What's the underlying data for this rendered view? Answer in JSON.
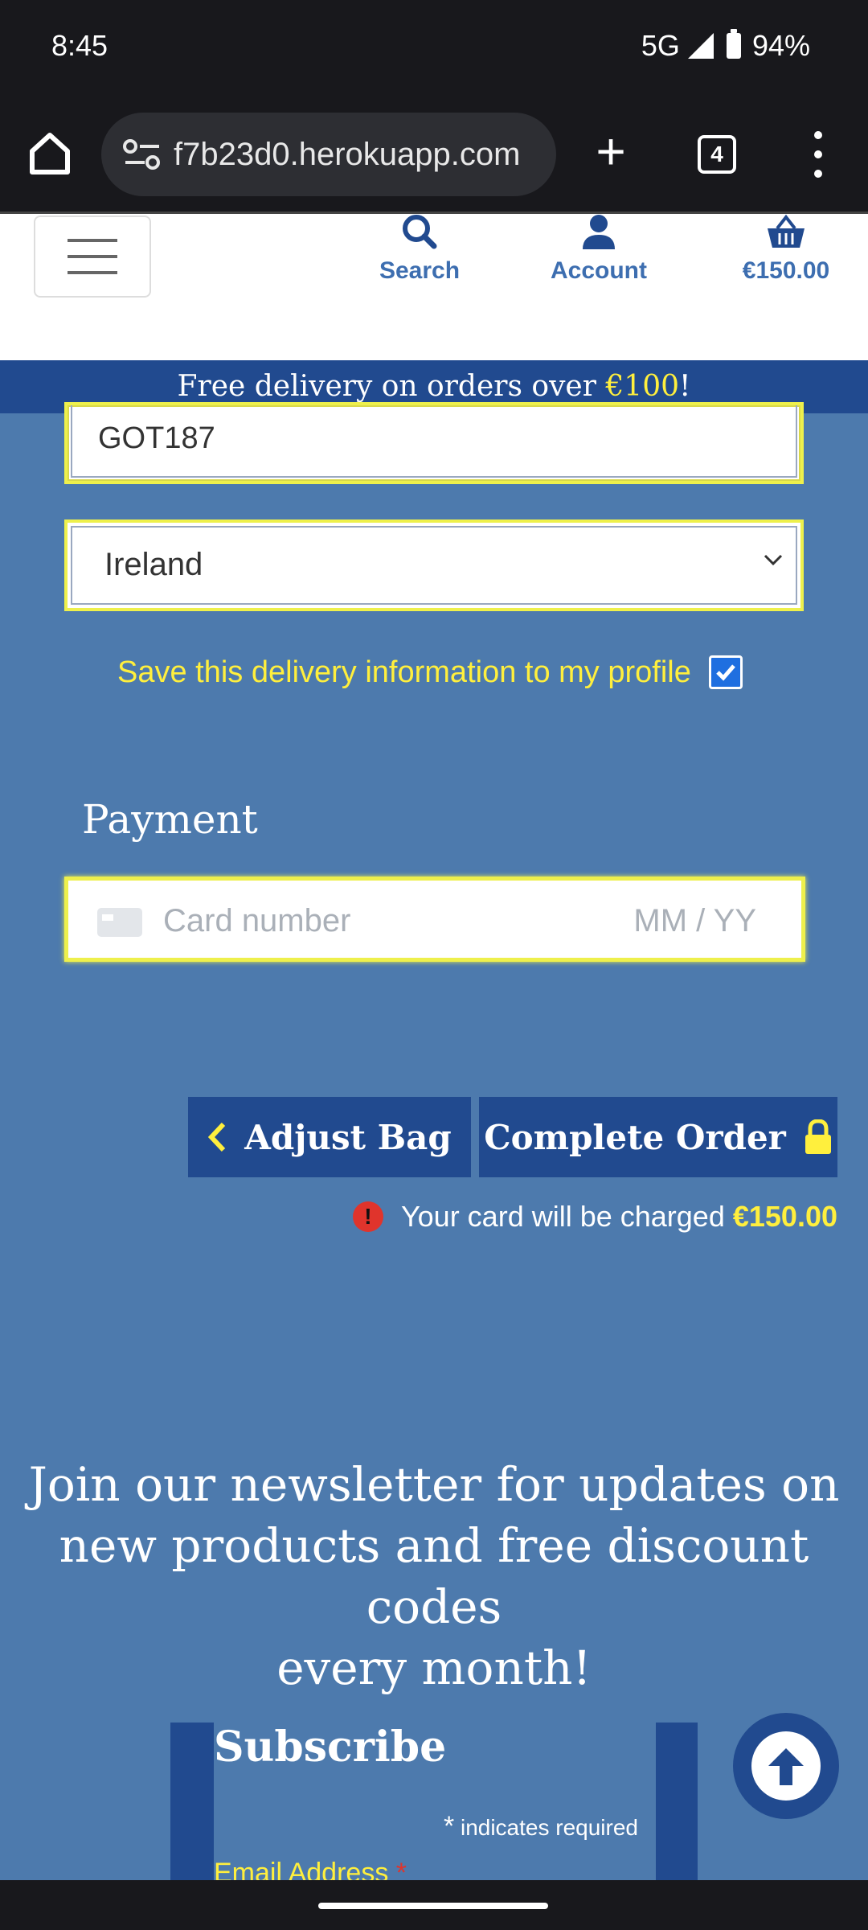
{
  "status_bar": {
    "time": "8:45",
    "network": "5G",
    "battery": "94%"
  },
  "browser": {
    "url": "f7b23d0.herokuapp.com",
    "tab_count": "4"
  },
  "header": {
    "search_label": "Search",
    "account_label": "Account",
    "bag_total": "€150.00"
  },
  "promo": {
    "prefix": "Free delivery on orders over ",
    "amount": "€100",
    "suffix": "!"
  },
  "form": {
    "postcode_value": "GOT187",
    "country_value": "Ireland",
    "save_label": "Save this delivery information to my profile",
    "save_checked": true,
    "payment_title": "Payment",
    "card_placeholder": "Card number",
    "expiry_placeholder": "MM / YY"
  },
  "buttons": {
    "adjust_bag": "Adjust Bag",
    "complete_order": "Complete Order"
  },
  "charge_note": {
    "text": "Your card will be charged ",
    "amount": "€150.00",
    "icon": "!"
  },
  "newsletter": {
    "line1": "Join our newsletter for updates on",
    "line2": "new products and free discount codes",
    "line3": "every month!"
  },
  "subscribe": {
    "title": "Subscribe",
    "required_star": "*",
    "required_note": "indicates required",
    "email_label": "Email Address",
    "email_asterisk": "*"
  },
  "colors": {
    "accent_yellow": "#ffef3d",
    "brand_blue": "#214a8f",
    "page_blue": "#4d7aad"
  }
}
